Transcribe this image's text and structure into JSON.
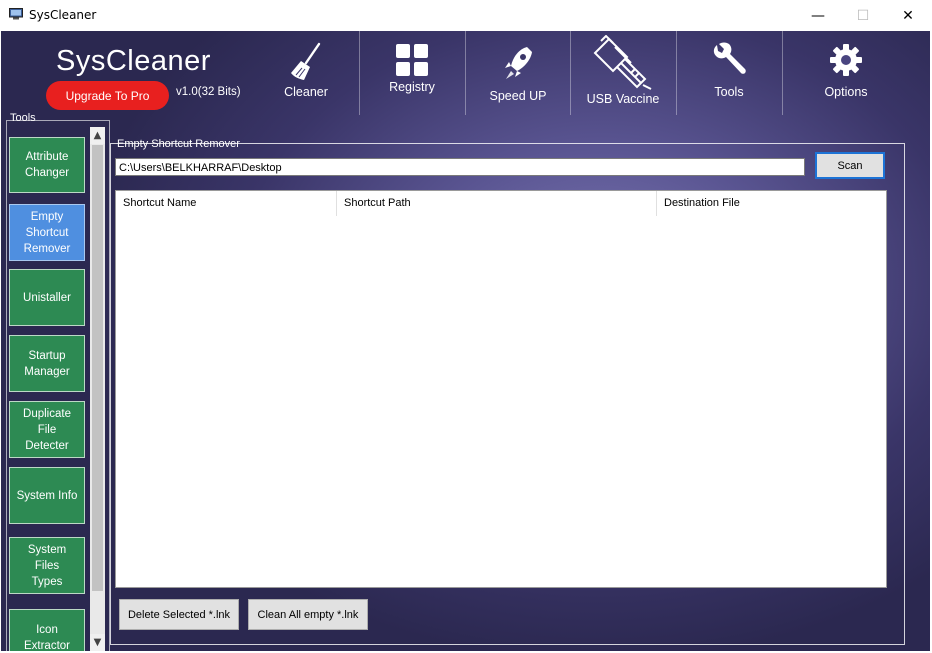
{
  "window": {
    "title": "SysCleaner",
    "minimize_glyph": "—",
    "maximize_glyph": "☐",
    "close_glyph": "✕"
  },
  "header": {
    "brand": "SysCleaner",
    "upgrade_label": "Upgrade To Pro",
    "version": "v1.0(32 Bits)",
    "nav": [
      {
        "label": "Cleaner",
        "icon": "broom-icon"
      },
      {
        "label": "Registry",
        "icon": "grid-icon"
      },
      {
        "label": "Speed UP",
        "icon": "rocket-icon"
      },
      {
        "label": "USB Vaccine",
        "icon": "usb-syringe-icon"
      },
      {
        "label": "Tools",
        "icon": "wrench-icon"
      },
      {
        "label": "Options",
        "icon": "gear-icon"
      }
    ]
  },
  "sidebar": {
    "label": "Tools",
    "items": [
      {
        "label": "Attribute\nChanger",
        "active": false
      },
      {
        "label": "Empty\nShortcut\nRemover",
        "active": true
      },
      {
        "label": "Unistaller",
        "active": false
      },
      {
        "label": "Startup\nManager",
        "active": false
      },
      {
        "label": "Duplicate\nFile\nDetecter",
        "active": false
      },
      {
        "label": "System Info",
        "active": false
      },
      {
        "label": "System\nFiles\nTypes",
        "active": false
      },
      {
        "label": "Icon\nExtractor",
        "active": false
      }
    ],
    "scroll_up_glyph": "▲",
    "scroll_down_glyph": "▼"
  },
  "main": {
    "group_title": "Empty Shortcut Remover",
    "path_value": "C:\\Users\\BELKHARRAF\\Desktop",
    "scan_label": "Scan",
    "columns": [
      "Shortcut Name",
      "Shortcut Path",
      "Destination File"
    ],
    "rows": [],
    "delete_selected_label": "Delete Selected *.lnk",
    "clean_all_label": "Clean All empty *.lnk"
  },
  "colors": {
    "accent_red": "#e8201f",
    "sidebar_green": "#2d8a53",
    "sidebar_active_blue": "#4f8fe0",
    "background_purple": "#5a5592",
    "scan_border_blue": "#1c73d6"
  }
}
